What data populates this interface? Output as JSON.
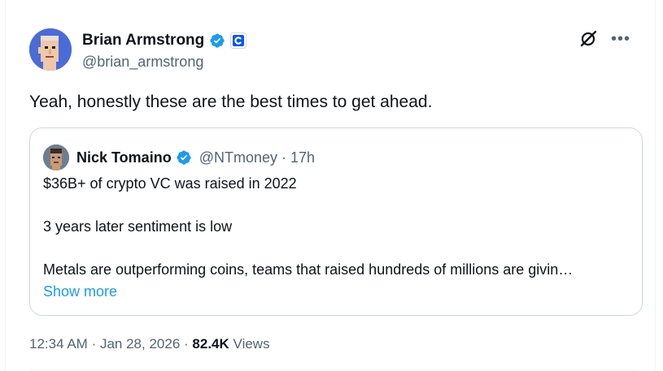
{
  "author": {
    "name": "Brian Armstrong",
    "handle": "@brian_armstrong"
  },
  "tweet": {
    "text": "Yeah, honestly these are the best times to get ahead."
  },
  "quoted": {
    "name": "Nick Tomaino",
    "handle": "@NTmoney",
    "separator": "·",
    "time": "17h",
    "lines": [
      "$36B+ of crypto VC was raised in 2022",
      "3 years later sentiment is low",
      "Metals are outperforming coins, teams that raised hundreds of millions are givin…"
    ],
    "show_more": "Show more"
  },
  "meta": {
    "time": "12:34 AM",
    "separator": "·",
    "date": "Jan 28, 2026",
    "views_count": "82.4K",
    "views_label": "Views"
  },
  "colors": {
    "accent": "#1d9bf0",
    "verified": "#1d9bf0",
    "coinbase": "#0052ff",
    "text": "#0f1419",
    "secondary": "#536471"
  },
  "icons": {
    "verified": "verified-badge-icon",
    "affiliate": "coinbase-affiliate-icon",
    "grok": "grok-icon",
    "more": "more-icon"
  }
}
